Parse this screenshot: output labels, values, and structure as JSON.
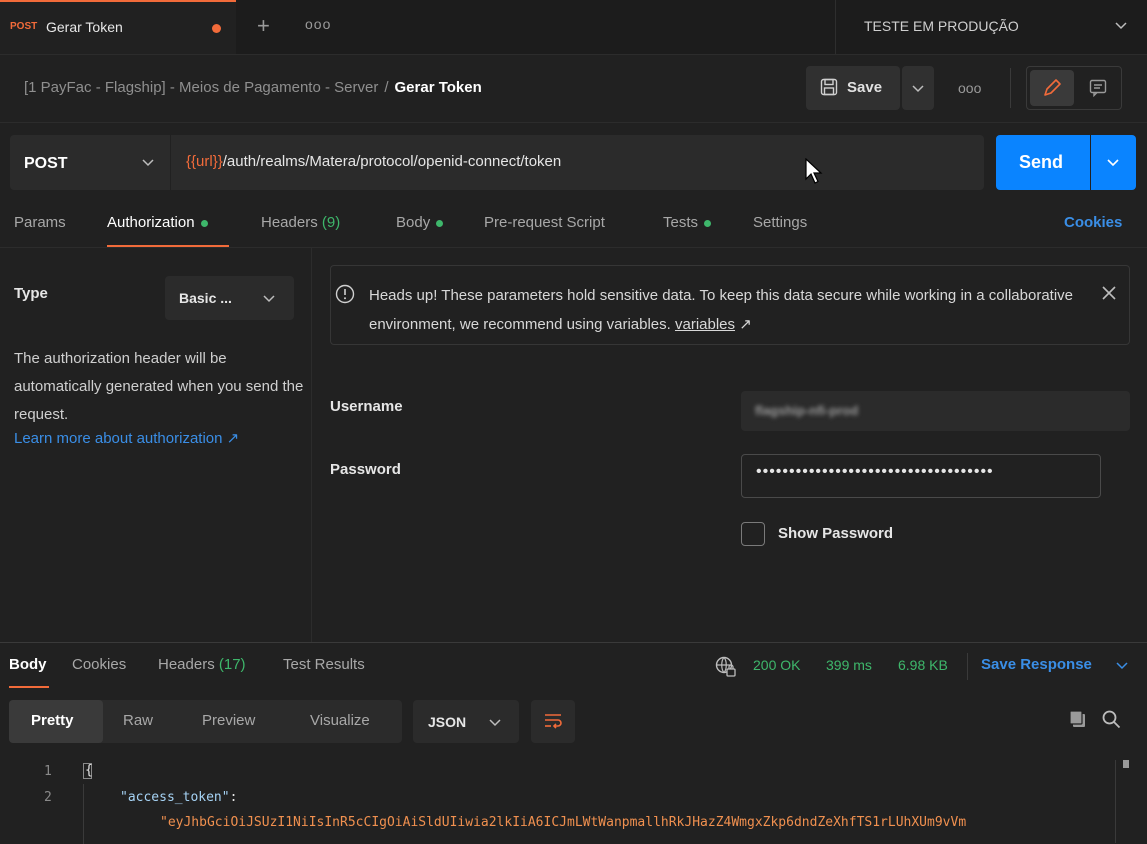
{
  "tab": {
    "method": "POST",
    "title": "Gerar Token"
  },
  "environment": {
    "name": "TESTE EM PRODUÇÃO"
  },
  "breadcrumb": {
    "path": "[1 PayFac - Flagship] - Meios de Pagamento - Server",
    "separator": "/",
    "current": "Gerar Token"
  },
  "toolbar": {
    "save_label": "Save",
    "more": "ooo"
  },
  "request": {
    "method": "POST",
    "url_var": "{{url}}",
    "url_path": "/auth/realms/Matera/protocol/openid-connect/token",
    "send_label": "Send"
  },
  "request_tabs": {
    "params": "Params",
    "authorization": "Authorization",
    "headers": "Headers",
    "headers_count": "(9)",
    "body": "Body",
    "prerequest": "Pre-request Script",
    "tests": "Tests",
    "settings": "Settings",
    "cookies": "Cookies"
  },
  "auth": {
    "type_label": "Type",
    "type_value": "Basic ...",
    "description": "The authorization header will be automatically generated when you send the request.",
    "learn_more": "Learn more about authorization ↗",
    "banner_text": "Heads up! These parameters hold sensitive data. To keep this data secure while working in a collaborative environment, we recommend using variables.",
    "banner_link": "variables",
    "banner_link_arrow": "↗",
    "username_label": "Username",
    "username_value": "flagship-nfi-prod",
    "password_label": "Password",
    "password_value": "••••••••••••••••••••••••••••••••••••",
    "show_password": "Show Password"
  },
  "response_tabs": {
    "body": "Body",
    "cookies": "Cookies",
    "headers": "Headers",
    "headers_count": "(17)",
    "test_results": "Test Results"
  },
  "response_status": {
    "status": "200 OK",
    "time": "399 ms",
    "size": "6.98 KB",
    "save_response": "Save Response"
  },
  "view_tabs": {
    "pretty": "Pretty",
    "raw": "Raw",
    "preview": "Preview",
    "visualize": "Visualize",
    "format": "JSON"
  },
  "code": {
    "line1_no": "1",
    "line2_no": "2",
    "line1": "{",
    "key": "\"access_token\"",
    "colon": ":",
    "value": "\"eyJhbGciOiJSUzI1NiIsInR5cCIgOiAiSldUIiwia2lkIiA6ICJmLWtWanpmallhRkJHazZ4WmgxZkp6dndZeXhfTS1rLUhXUm9vVm"
  },
  "colors": {
    "accent": "#f26b3a",
    "primary": "#0a84ff",
    "success": "#3eb76b",
    "link": "#3a8ee6"
  }
}
